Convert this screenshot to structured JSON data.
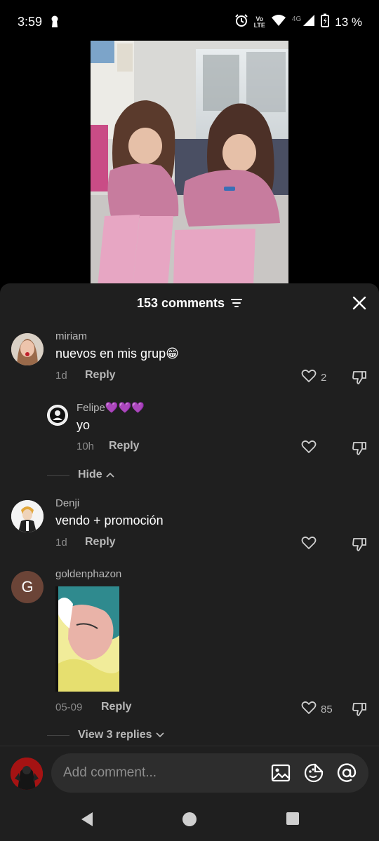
{
  "status_bar": {
    "time": "3:59",
    "volte_top": "Vo",
    "volte_bottom": "LTE",
    "network": "4G",
    "battery": "13 %"
  },
  "sheet": {
    "title": "153 comments",
    "bg": "#1f1f1f"
  },
  "comments": [
    {
      "username": "miriam",
      "text": "nuevos en mis grup😁",
      "time": "1d",
      "reply_label": "Reply",
      "likes": "2",
      "replies": [
        {
          "username": "Felipe💜💜💜",
          "text": "yo",
          "time": "10h",
          "reply_label": "Reply"
        }
      ],
      "hide_label": "Hide"
    },
    {
      "username": "Denji",
      "text": "vendo + promoción",
      "time": "1d",
      "reply_label": "Reply"
    },
    {
      "username": "goldenphazon",
      "avatar_letter": "G",
      "time": "05-09",
      "reply_label": "Reply",
      "likes": "85",
      "view_replies": "View 3 replies"
    }
  ],
  "composer": {
    "placeholder": "Add comment..."
  }
}
